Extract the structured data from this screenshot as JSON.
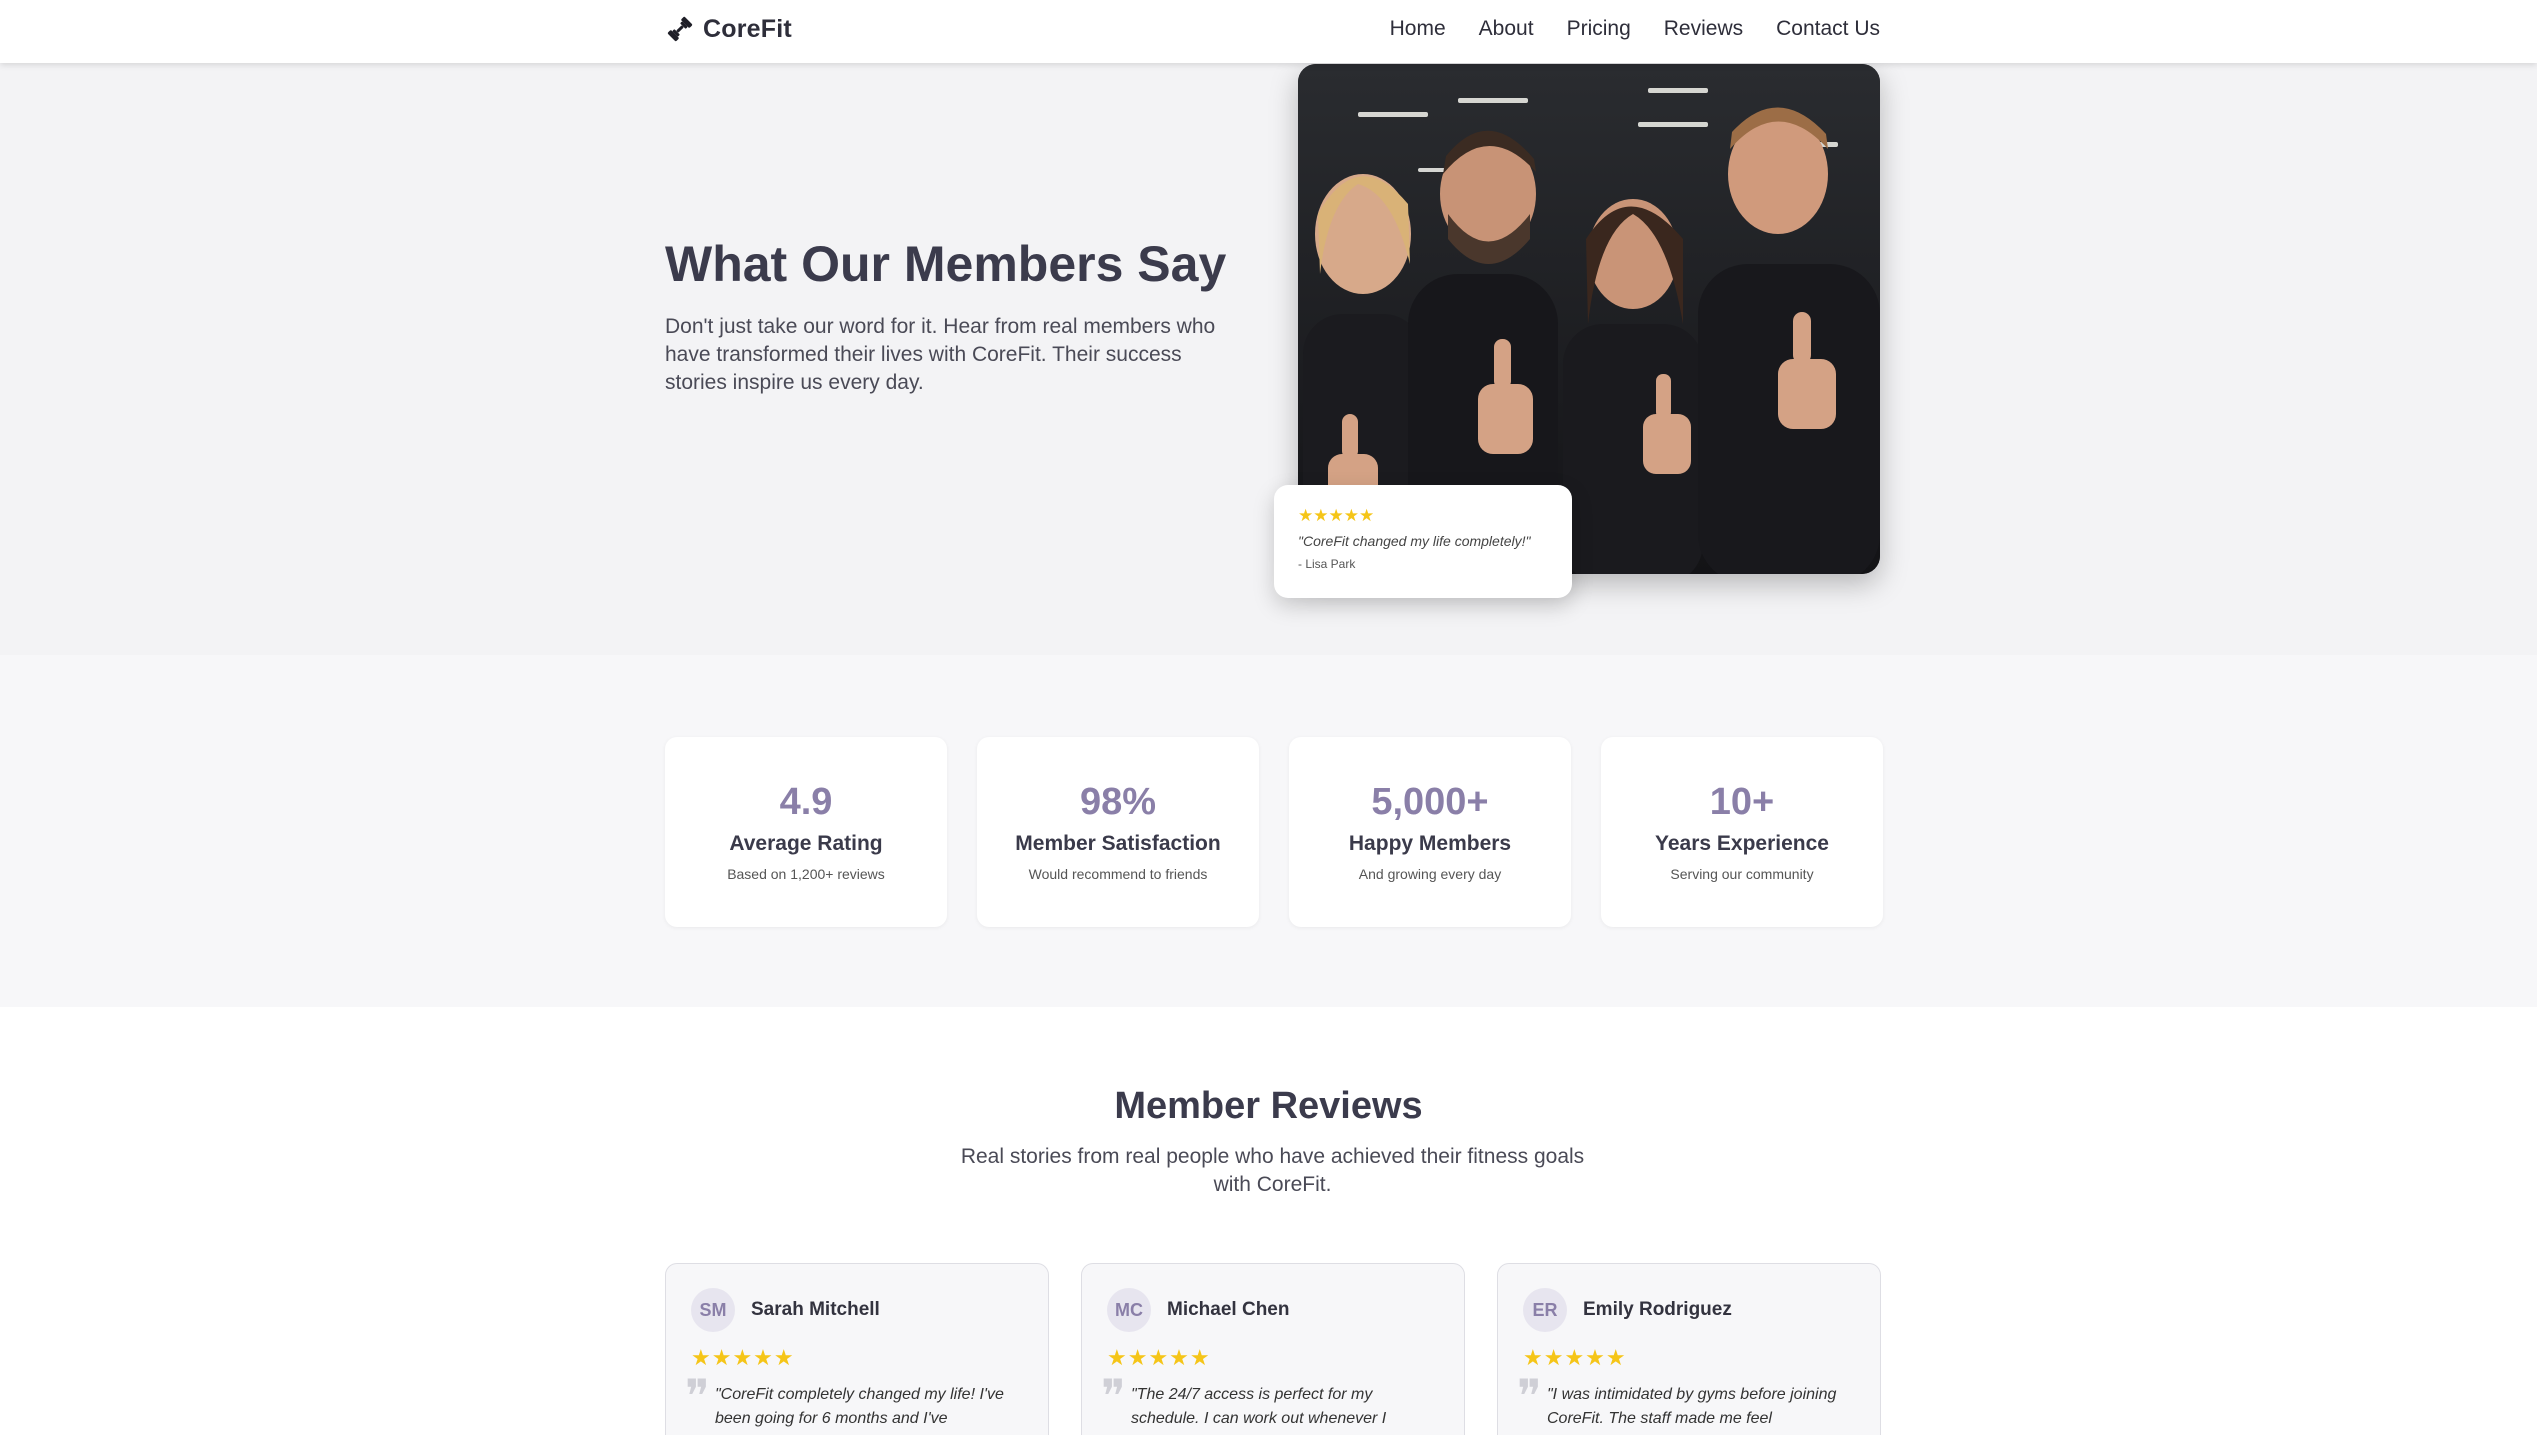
{
  "nav": {
    "brand": "CoreFit",
    "links": [
      "Home",
      "About",
      "Pricing",
      "Reviews",
      "Contact Us"
    ]
  },
  "hero": {
    "title": "What Our Members Say",
    "description": "Don't just take our word for it. Hear from real members who have transformed their lives with CoreFit. Their success stories inspire us every day.",
    "quote_card": {
      "stars": "★★★★★",
      "text": "\"CoreFit changed my life completely!\"",
      "author": "- Lisa Park"
    }
  },
  "stats": [
    {
      "value": "4.9",
      "label": "Average Rating",
      "sub": "Based on 1,200+ reviews"
    },
    {
      "value": "98%",
      "label": "Member Satisfaction",
      "sub": "Would recommend to friends"
    },
    {
      "value": "5,000+",
      "label": "Happy Members",
      "sub": "And growing every day"
    },
    {
      "value": "10+",
      "label": "Years Experience",
      "sub": "Serving our community"
    }
  ],
  "reviews": {
    "title": "Member Reviews",
    "subtitle": "Real stories from real people who have achieved their fitness goals with CoreFit.",
    "items": [
      {
        "initials": "SM",
        "name": "Sarah Mitchell",
        "stars": "★★★★★",
        "text": "\"CoreFit completely changed my life! I've been going for 6 months and I've"
      },
      {
        "initials": "MC",
        "name": "Michael Chen",
        "stars": "★★★★★",
        "text": "\"The 24/7 access is perfect for my schedule. I can work out whenever I"
      },
      {
        "initials": "ER",
        "name": "Emily Rodriguez",
        "stars": "★★★★★",
        "text": "\"I was intimidated by gyms before joining CoreFit. The staff made me feel"
      }
    ]
  },
  "colors": {
    "accent": "#8a7fa8",
    "star": "#f5c518",
    "heading": "#3b3b4c"
  }
}
